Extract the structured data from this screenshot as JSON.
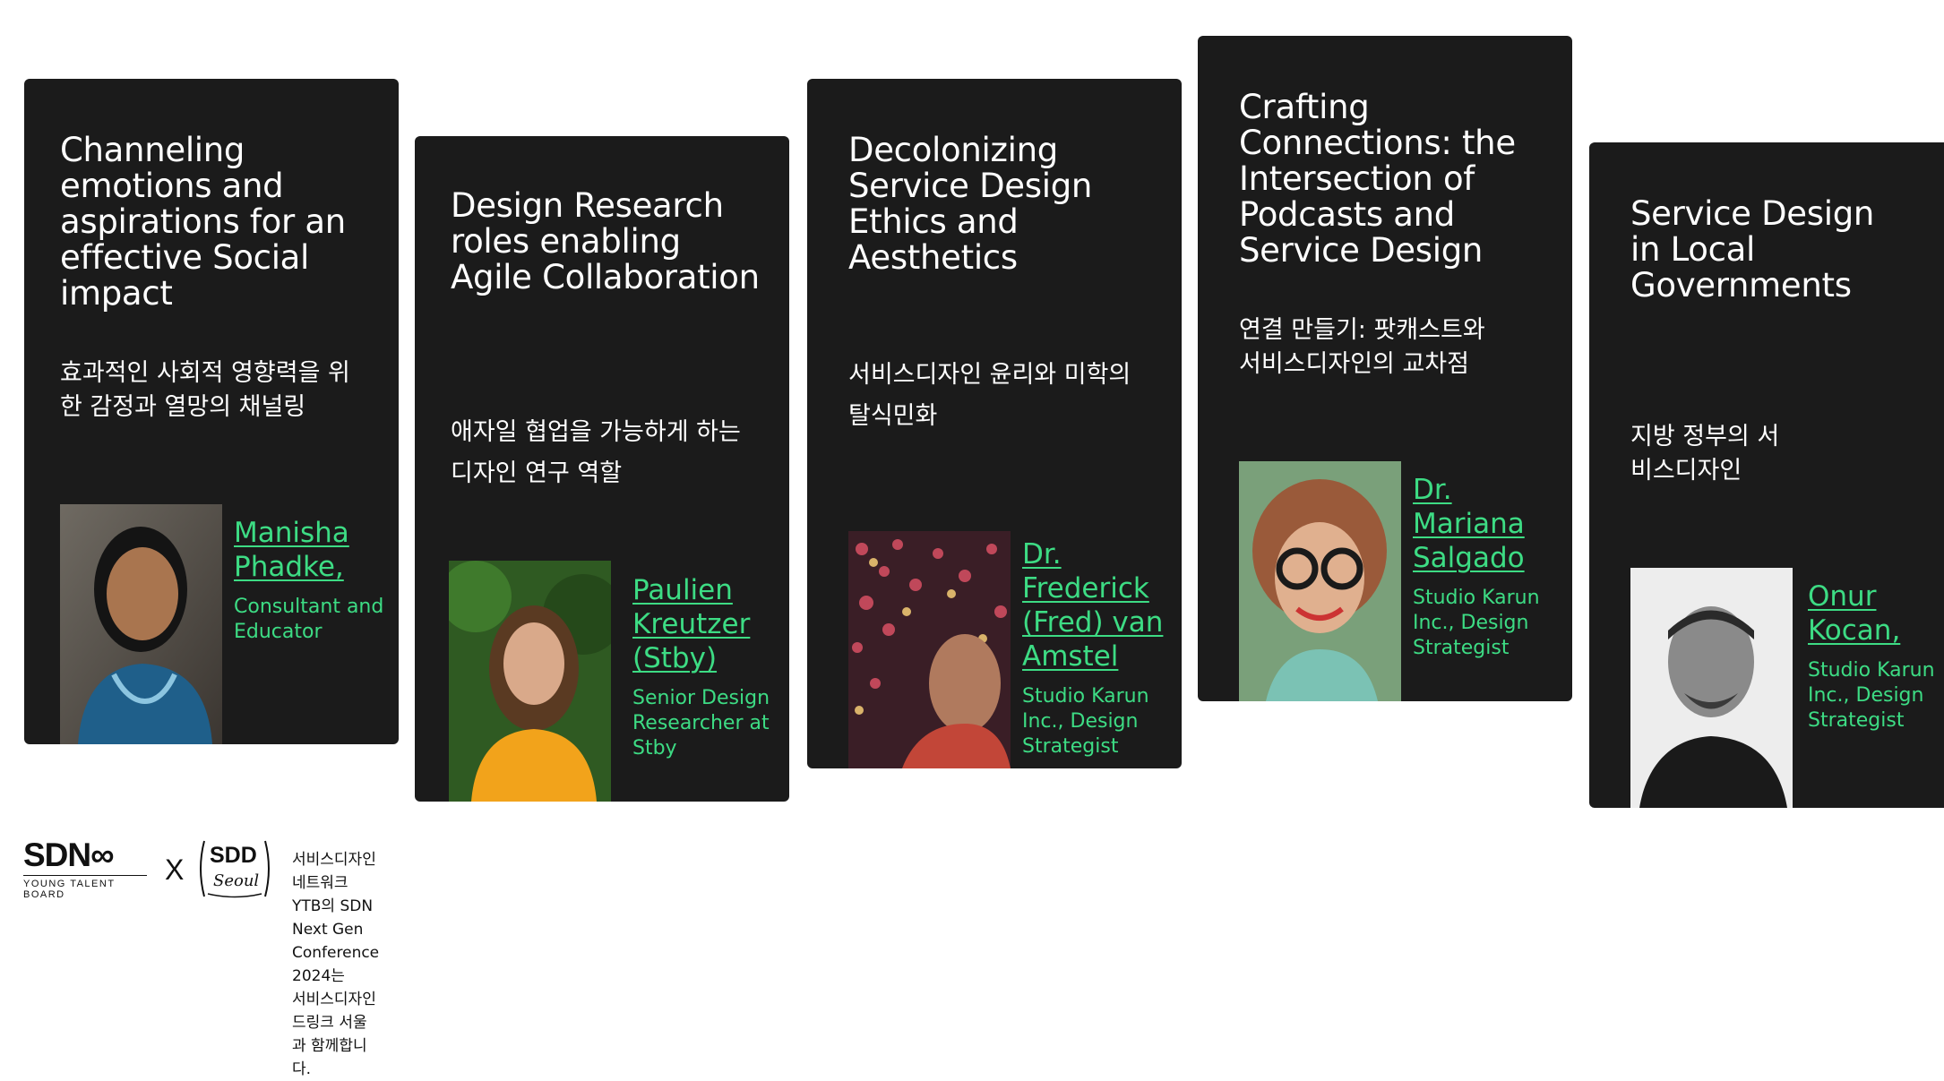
{
  "cards": [
    {
      "title": "Channeling emotions and aspirations for an effective Social impact",
      "korean": "효과적인 사회적 영향력을 위한 감정과 열망의 채널링",
      "speaker_name": "Manisha Phadke,",
      "speaker_role": "Consultant and Educator"
    },
    {
      "title": "Design Research roles enabling Agile Collaboration",
      "korean": "애자일 협업을 가능하게 하는 디자인 연구 역할",
      "speaker_name": "Paulien Kreutzer (Stby)",
      "speaker_role": "Senior Design Researcher at Stby"
    },
    {
      "title": "Decolonizing Service Design Ethics and Aesthetics",
      "korean": "서비스디자인 윤리와 미학의 탈식민화",
      "speaker_name": "Dr. Frederick (Fred) van Amstel",
      "speaker_role": "Studio Karun Inc., Design Strategist"
    },
    {
      "title": "Crafting Connections: the Intersection of Podcasts and Service Design",
      "korean": "연결 만들기: 팟캐스트와 서비스디자인의 교차점",
      "speaker_name": "Dr. Mariana Salgado",
      "speaker_role": "Studio Karun Inc., Design Strategist"
    },
    {
      "title": "Service Design in Local Governments",
      "korean": "지방 정부의 서비스디자인",
      "speaker_name": "Onur Kocan,",
      "speaker_role": "Studio Karun Inc., Design Strategist"
    }
  ],
  "footer": {
    "sdn_logo": "SDN",
    "sdn_sub": "YOUNG TALENT BOARD",
    "x": "X",
    "sdd_logo": "SDD",
    "sdd_script": "Seoul",
    "line1": "서비스디자인 네트워크 YTB의 SDN Next Gen Conference 2024는",
    "line2": "서비스디자인드링크 서울과 함께합니다."
  },
  "colors": {
    "card_bg": "#1b1b1b",
    "accent": "#3ddc84",
    "text": "#ffffff"
  }
}
